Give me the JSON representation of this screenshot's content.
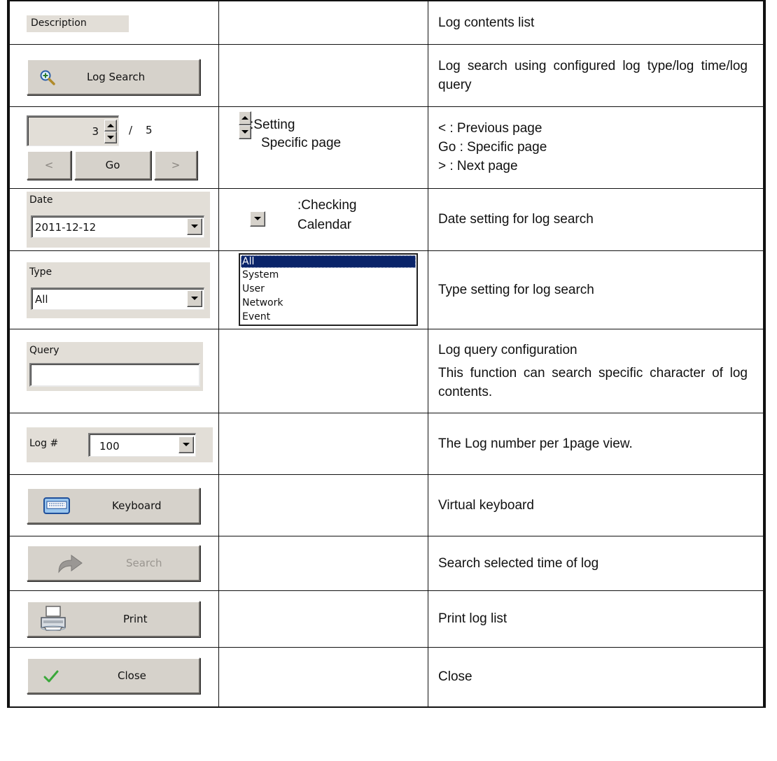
{
  "rows": [
    {
      "widget": {
        "header_label": "Description"
      },
      "note": "",
      "description": [
        "Log contents list"
      ]
    },
    {
      "widget": {
        "button_label": "Log Search",
        "icon": "magnifier-plus-icon"
      },
      "note": "",
      "description": [
        "Log search using configured log type/log time/log query"
      ]
    },
    {
      "widget": {
        "page_value": "3",
        "separator": "/",
        "page_total": "5",
        "prev_label": "<",
        "go_label": "Go",
        "next_label": ">"
      },
      "note": {
        "text1": ":Setting",
        "text2": "Specific page",
        "icon": "spinner-icon"
      },
      "description": [
        "< : Previous page",
        "Go : Specific page",
        "> : Next page"
      ]
    },
    {
      "widget": {
        "label": "Date",
        "value": "2011-12-12"
      },
      "note": {
        "text1": ":Checking",
        "text2": "Calendar",
        "icon": "dropdown-arrow-icon"
      },
      "description": [
        "Date setting for log search"
      ]
    },
    {
      "widget": {
        "label": "Type",
        "value": "All"
      },
      "note": {
        "options": [
          "All",
          "System",
          "User",
          "Network",
          "Event"
        ],
        "selected": "All"
      },
      "description": [
        "Type setting for log search"
      ]
    },
    {
      "widget": {
        "label": "Query",
        "value": ""
      },
      "note": "",
      "description": [
        "Log query configuration",
        "This function can search specific character of log contents."
      ]
    },
    {
      "widget": {
        "label": "Log #",
        "value": "100"
      },
      "note": "",
      "description": [
        "The Log number per 1page view."
      ]
    },
    {
      "widget": {
        "button_label": "Keyboard",
        "icon": "keyboard-icon"
      },
      "note": "",
      "description": [
        "Virtual keyboard"
      ]
    },
    {
      "widget": {
        "button_label": "Search",
        "icon": "arrow-right-icon",
        "disabled": true
      },
      "note": "",
      "description": [
        "Search selected time of log"
      ]
    },
    {
      "widget": {
        "button_label": "Print",
        "icon": "printer-icon"
      },
      "note": "",
      "description": [
        "Print log list"
      ]
    },
    {
      "widget": {
        "button_label": "Close",
        "icon": "checkmark-icon"
      },
      "note": "",
      "description": [
        "Close"
      ]
    }
  ],
  "colors": {
    "button_face": "#d6d2cb",
    "panel": "#e2ded7",
    "selection": "#0a246a",
    "disabled_text": "#9a9690"
  }
}
